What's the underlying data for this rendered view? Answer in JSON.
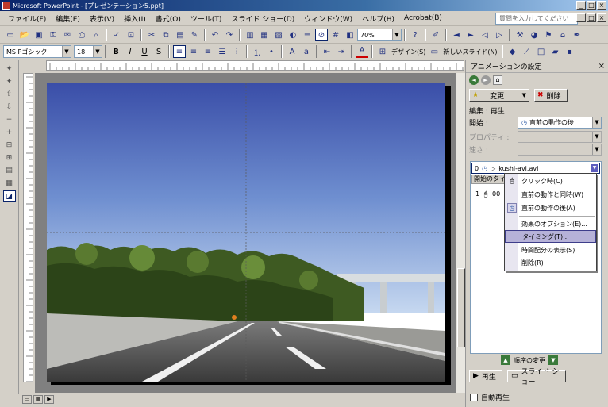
{
  "window": {
    "title": "Microsoft PowerPoint - [プレゼンテーション5.ppt]",
    "min": "_",
    "max": "□",
    "close": "×"
  },
  "menu": {
    "items": [
      "ファイル(F)",
      "編集(E)",
      "表示(V)",
      "挿入(I)",
      "書式(O)",
      "ツール(T)",
      "スライド ショー(D)",
      "ウィンドウ(W)",
      "ヘルプ(H)",
      "Acrobat(B)"
    ],
    "help_placeholder": "質問を入力してください"
  },
  "toolbar1": {
    "zoom": "70%"
  },
  "toolbar2": {
    "font": "MS Pゴシック",
    "size": "18",
    "bold": "B",
    "italic": "I",
    "underline": "U",
    "shadow": "S",
    "design_label": "デザイン(S)",
    "new_slide_label": "新しいスライド(N)"
  },
  "task_pane": {
    "title": "アニメーションの設定",
    "close": "×",
    "change_label": "変更",
    "delete_label": "削除",
    "edit_label": "編集 : 再生",
    "start_label": "開始 :",
    "start_value": "直前の動作の後",
    "property_label": "プロパティ :",
    "speed_label": "速さ :",
    "list": {
      "selected_item": "kushi-avi.avi",
      "selected_index": "0",
      "column_header": "開始のタイミング",
      "row1_index": "1",
      "row1_text": "00"
    },
    "reorder_label": "順序の変更",
    "play_label": "再生",
    "slideshow_label": "スライド ショー",
    "autoplay_label": "自動再生"
  },
  "context_menu": {
    "items": [
      "クリック時(C)",
      "直前の動作と同時(W)",
      "直前の動作の後(A)",
      "効果のオプション(E)...",
      "タイミング(T)...",
      "時間配分の表示(S)",
      "削除(R)"
    ],
    "highlighted": "タイミング(T)..."
  },
  "colors": {
    "titlebar": "#0a246a",
    "highlight": "#b6b2d8",
    "sky_top": "#3a4ea8",
    "sky_bottom": "#c6d8f0"
  }
}
